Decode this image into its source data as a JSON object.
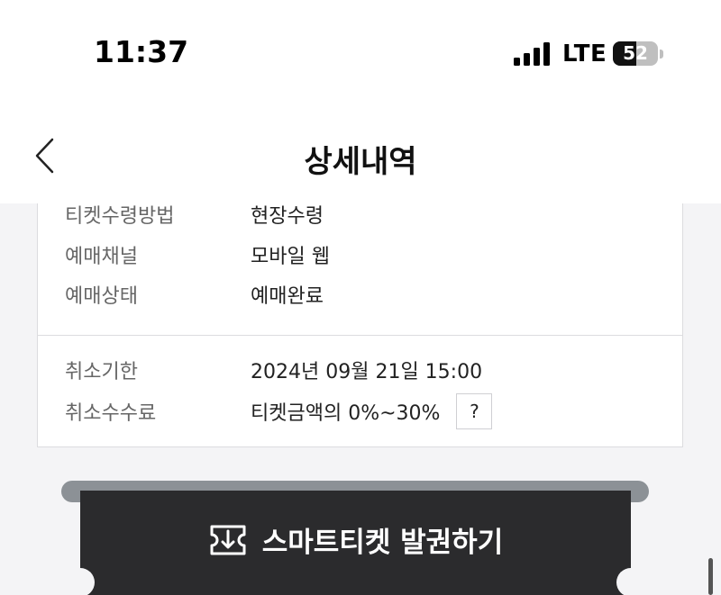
{
  "status_bar": {
    "time": "11:37",
    "network": "LTE",
    "battery_level": "52",
    "icons": [
      "signal-icon",
      "battery-icon"
    ]
  },
  "header": {
    "title": "상세내역",
    "back_icon": "chevron-left-icon"
  },
  "details": {
    "rows": [
      {
        "label": "티켓수령방법",
        "value": "현장수령"
      },
      {
        "label": "예매채널",
        "value": "모바일 웹"
      },
      {
        "label": "예매상태",
        "value": "예매완료"
      }
    ],
    "cancel_rows": [
      {
        "label": "취소기한",
        "value": "2024년 09월 21일 15:00"
      },
      {
        "label": "취소수수료",
        "value": "티켓금액의 0%~30%"
      }
    ],
    "help_label": "?"
  },
  "ticket_button": {
    "label": "스마트티켓 발권하기",
    "icon": "ticket-icon"
  },
  "colors": {
    "button_bg": "#2b2b2d",
    "rail": "#8c9196",
    "background": "#f4f4f6"
  }
}
